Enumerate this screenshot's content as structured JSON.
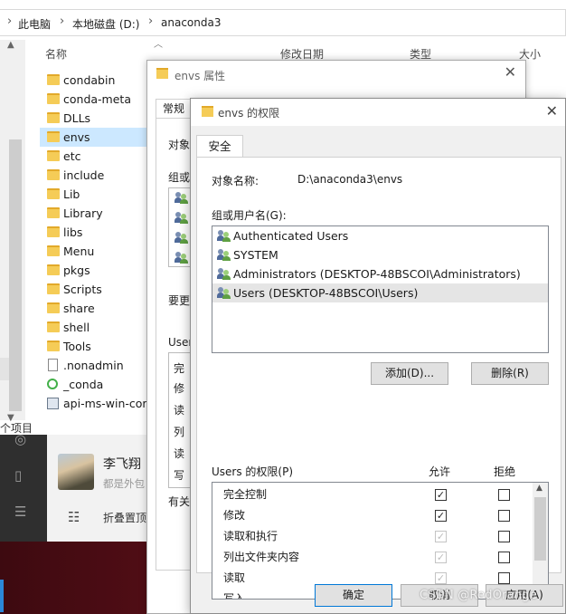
{
  "explorer": {
    "breadcrumb": [
      "此电脑",
      "本地磁盘 (D:)",
      "anaconda3"
    ],
    "columns": {
      "name": "名称",
      "modified": "修改日期",
      "type": "类型",
      "size": "大小"
    },
    "files": [
      {
        "name": "condabin",
        "kind": "folder"
      },
      {
        "name": "conda-meta",
        "kind": "folder"
      },
      {
        "name": "DLLs",
        "kind": "folder"
      },
      {
        "name": "envs",
        "kind": "folder",
        "selected": true
      },
      {
        "name": "etc",
        "kind": "folder"
      },
      {
        "name": "include",
        "kind": "folder"
      },
      {
        "name": "Lib",
        "kind": "folder"
      },
      {
        "name": "Library",
        "kind": "folder"
      },
      {
        "name": "libs",
        "kind": "folder"
      },
      {
        "name": "Menu",
        "kind": "folder"
      },
      {
        "name": "pkgs",
        "kind": "folder"
      },
      {
        "name": "Scripts",
        "kind": "folder"
      },
      {
        "name": "share",
        "kind": "folder"
      },
      {
        "name": "shell",
        "kind": "folder"
      },
      {
        "name": "Tools",
        "kind": "folder"
      },
      {
        "name": ".nonadmin",
        "kind": "file"
      },
      {
        "name": "_conda",
        "kind": "conda"
      },
      {
        "name": "api-ms-win-core",
        "kind": "api"
      }
    ],
    "item_count": "个项目"
  },
  "chat": {
    "user_name": "李飞翔",
    "user_sub": "都是外包",
    "fold_label": "折叠置顶"
  },
  "properties_dialog": {
    "title": "envs 属性",
    "tab": "常规",
    "labels": [
      "对象",
      "组或",
      "要更",
      "Users",
      "有关"
    ],
    "perm_abbrev": [
      "完",
      "修",
      "读",
      "列",
      "读",
      "写"
    ]
  },
  "permissions_dialog": {
    "title": "envs 的权限",
    "tab": "安全",
    "object_label": "对象名称:",
    "object_value": "D:\\anaconda3\\envs",
    "group_label": "组或用户名(G):",
    "users": [
      {
        "name": "Authenticated Users"
      },
      {
        "name": "SYSTEM"
      },
      {
        "name": "Administrators (DESKTOP-48BSCOI\\Administrators)"
      },
      {
        "name": "Users (DESKTOP-48BSCOI\\Users)",
        "selected": true
      }
    ],
    "add_label": "添加(D)...",
    "remove_label": "删除(R)",
    "perm_header": "Users 的权限(P)",
    "allow_header": "允许",
    "deny_header": "拒绝",
    "permissions": [
      {
        "name": "完全控制",
        "allow": true,
        "allow_disabled": false,
        "deny": false
      },
      {
        "name": "修改",
        "allow": true,
        "allow_disabled": false,
        "deny": false
      },
      {
        "name": "读取和执行",
        "allow": true,
        "allow_disabled": true,
        "deny": false
      },
      {
        "name": "列出文件夹内容",
        "allow": true,
        "allow_disabled": true,
        "deny": false
      },
      {
        "name": "读取",
        "allow": true,
        "allow_disabled": true,
        "deny": false
      },
      {
        "name": "写入",
        "allow": true,
        "allow_disabled": false,
        "deny": false
      }
    ],
    "ok_label": "确定",
    "cancel_label": "取消",
    "apply_label": "应用(A)"
  },
  "watermark": "CSDN @RedOrange"
}
